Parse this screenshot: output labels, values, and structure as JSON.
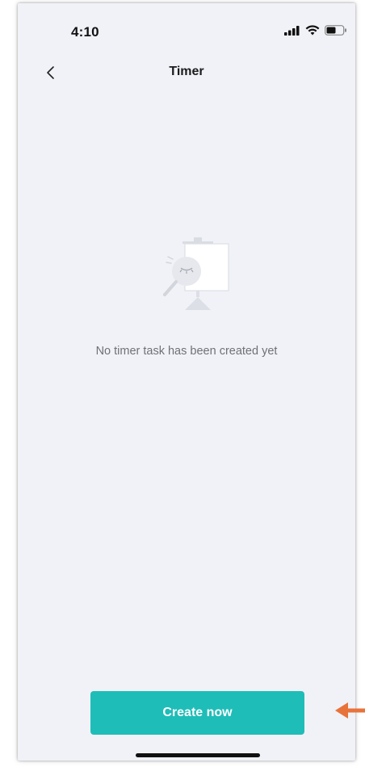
{
  "status_bar": {
    "time": "4:10",
    "icons": [
      "signal-icon",
      "wifi-icon",
      "battery-icon"
    ]
  },
  "nav": {
    "back_icon": "chevron-left-icon",
    "title": "Timer"
  },
  "empty_state": {
    "illustration": "easel-magnifier-illustration",
    "message": "No timer task has been created yet"
  },
  "actions": {
    "create_label": "Create now"
  },
  "colors": {
    "background": "#f1f2f7",
    "accent": "#1fbdb8",
    "annotation": "#e8733a"
  }
}
